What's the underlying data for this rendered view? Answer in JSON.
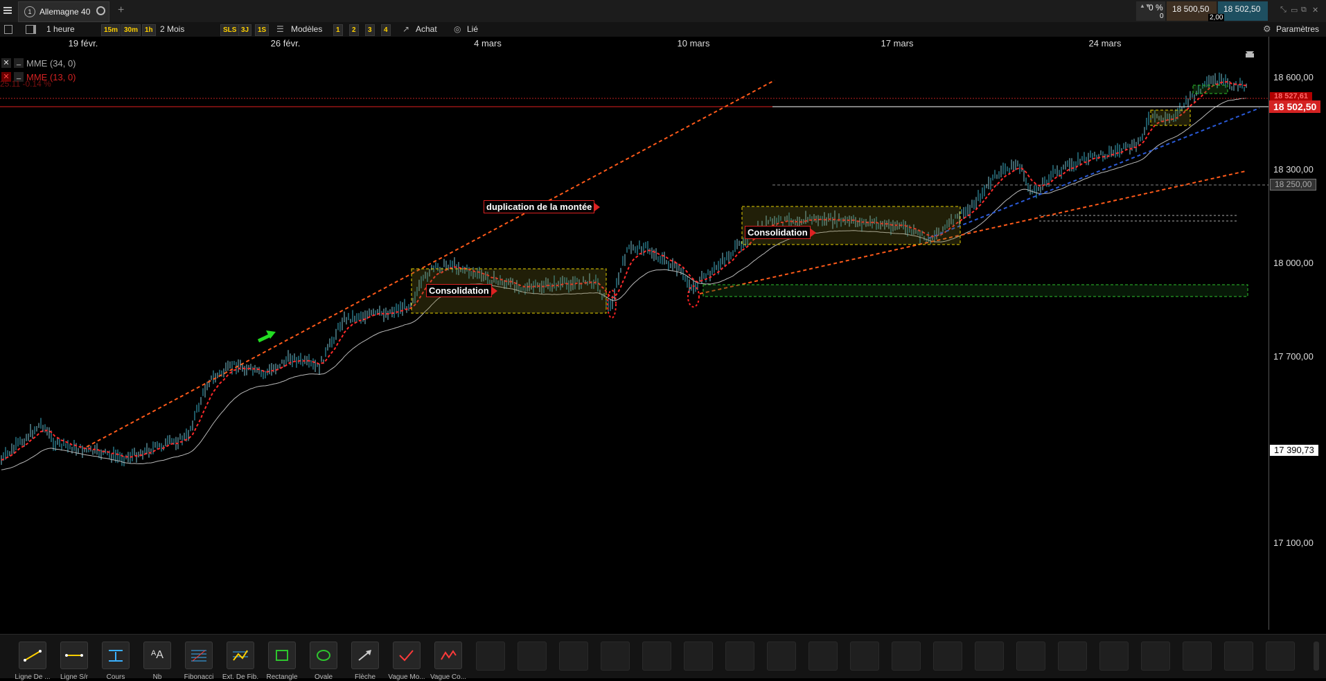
{
  "instrument": {
    "name": "Allemagne 40",
    "index": "1"
  },
  "quote": {
    "change_pct": "0 %",
    "change_val": "0",
    "bid": "18 500,50",
    "ask": "18 502,50",
    "spread": "2,00"
  },
  "toolbar": {
    "interval": "1 heure",
    "quick_intervals": [
      "15m",
      "30m",
      "1h"
    ],
    "range": "2 Mois",
    "quick_ranges": [
      "SLS",
      "3J",
      "1S"
    ],
    "models_label": "Modèles",
    "slots": [
      "1",
      "2",
      "3",
      "4"
    ],
    "achat_label": "Achat",
    "linked_label": "Lié",
    "settings_label": "Paramètres"
  },
  "dates": [
    "19 févr.",
    "26 févr.",
    "4 mars",
    "10 mars",
    "17 mars",
    "24 mars"
  ],
  "indicators": [
    {
      "label": "MME (34, 0)",
      "color": "#aaaaaa"
    },
    {
      "label": "MME (13, 0)",
      "color": "#d42222"
    }
  ],
  "indicator_hidden_text": "25.11 -0.14 %",
  "price_axis": {
    "labels": [
      "18 600,00",
      "18 300,00",
      "18 000,00",
      "17 700,00",
      "17 100,00"
    ],
    "current_price": "18 502,50",
    "hidden_price": "18 527,61",
    "level_marker": "18 250,00",
    "cursor_price": "17 390,73"
  },
  "annotations": {
    "duplication": "duplication de la montée",
    "consolidation_1": "Consolidation",
    "consolidation_2": "Consolidation"
  },
  "drawing_tools": [
    {
      "label": "Ligne De ...",
      "icon": "trend-line-icon"
    },
    {
      "label": "Ligne S/r",
      "icon": "horizontal-line-icon"
    },
    {
      "label": "Cours",
      "icon": "price-level-icon"
    },
    {
      "label": "Nb",
      "icon": "text-note-icon"
    },
    {
      "label": "Fibonacci",
      "icon": "fibonacci-icon"
    },
    {
      "label": "Ext. De Fib.",
      "icon": "fib-extension-icon"
    },
    {
      "label": "Rectangle",
      "icon": "rectangle-icon"
    },
    {
      "label": "Ovale",
      "icon": "oval-icon"
    },
    {
      "label": "Flèche",
      "icon": "arrow-icon"
    },
    {
      "label": "Vague Mo...",
      "icon": "wave-monowave-icon"
    },
    {
      "label": "Vague Co...",
      "icon": "wave-correction-icon"
    }
  ],
  "colors": {
    "accent_red": "#d42222",
    "accent_blue": "#1e4f8a",
    "candle": "#3ab0c8",
    "ema13": "#ff2a2a",
    "ema34": "#bbbbbb"
  }
}
